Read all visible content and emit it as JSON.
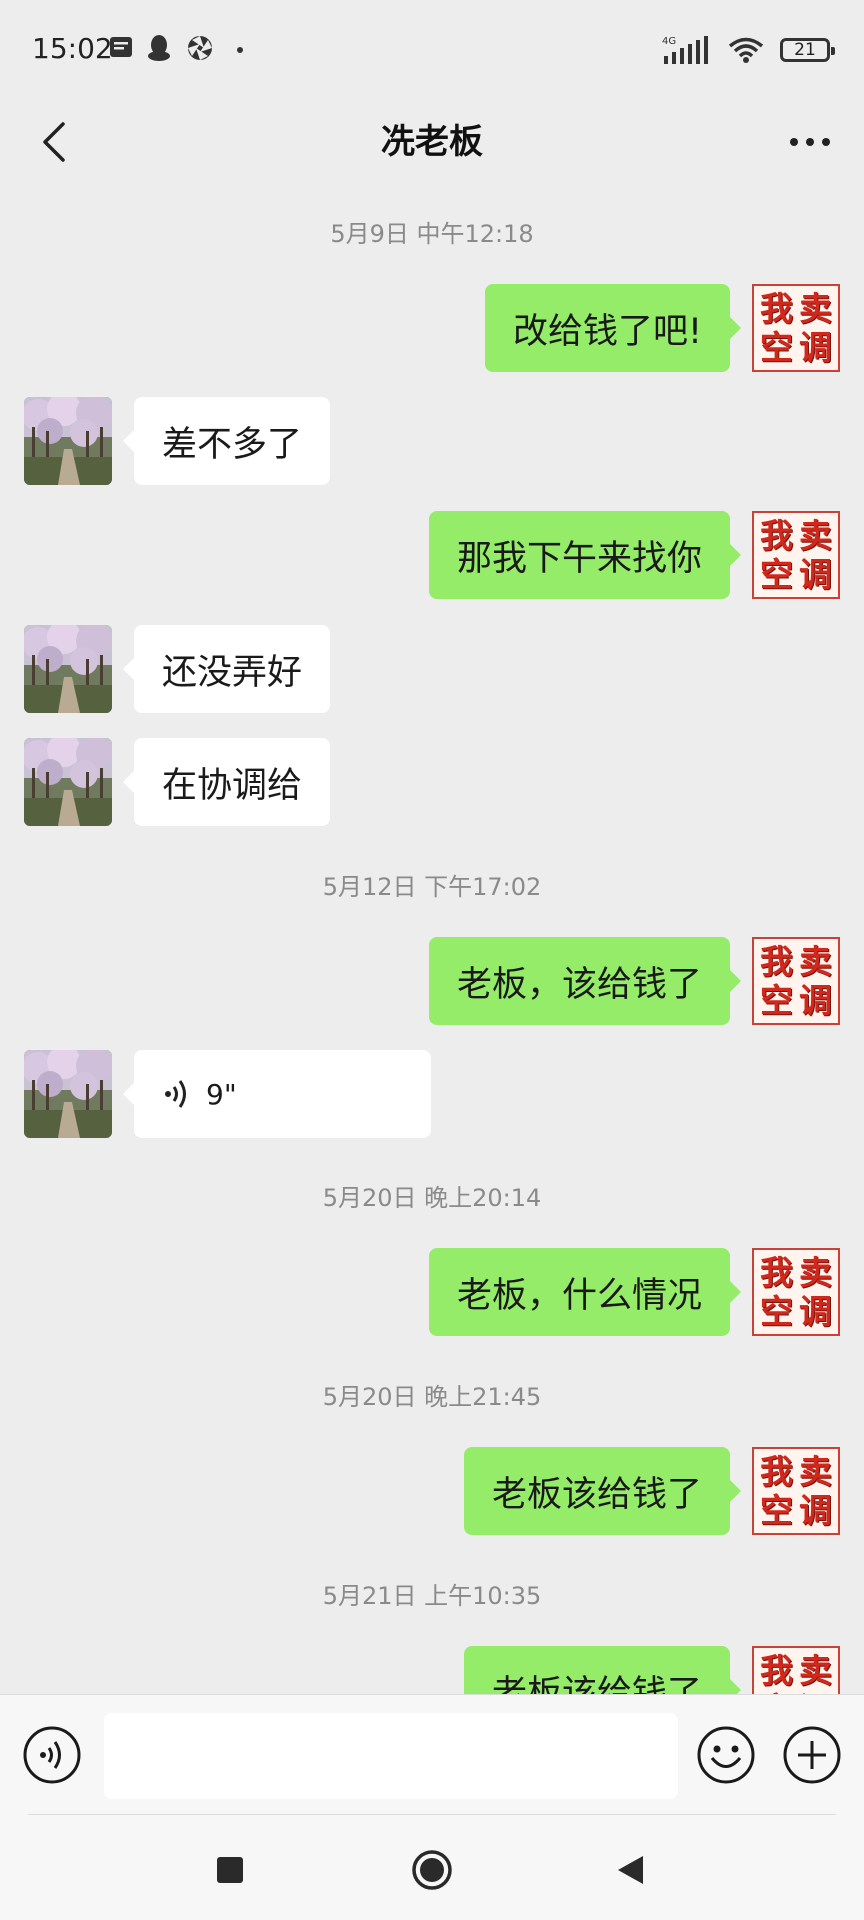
{
  "status_bar": {
    "time": "15:02",
    "network": "4G",
    "battery": "21"
  },
  "header": {
    "title": "冼老板"
  },
  "chat": {
    "timestamps": [
      "5月9日 中午12:18",
      "5月12日 下午17:02",
      "5月20日 晚上20:14",
      "5月20日 晚上21:45",
      "5月21日 上午10:35"
    ],
    "my_avatar_chars": [
      "我",
      "卖",
      "空",
      "调"
    ],
    "messages": [
      {
        "side": "right",
        "text": "改给钱了吧!"
      },
      {
        "side": "left",
        "text": "差不多了"
      },
      {
        "side": "right",
        "text": "那我下午来找你"
      },
      {
        "side": "left",
        "text": "还没弄好"
      },
      {
        "side": "left",
        "text": "在协调给"
      },
      {
        "side": "right",
        "text": "老板，该给钱了"
      },
      {
        "side": "left",
        "type": "voice",
        "text": "9\""
      },
      {
        "side": "right",
        "text": "老板，什么情况"
      },
      {
        "side": "right",
        "text": "老板该给钱了"
      },
      {
        "side": "right",
        "text": "老板该给钱了"
      }
    ]
  },
  "input": {
    "placeholder": ""
  },
  "icons": {
    "back": "chevron-left-icon",
    "more": "more-icon",
    "voice": "voice-icon",
    "emoji": "emoji-icon",
    "plus": "plus-icon"
  },
  "colors": {
    "my_bubble": "#95ec69",
    "their_bubble": "#ffffff",
    "background": "#ededed"
  }
}
